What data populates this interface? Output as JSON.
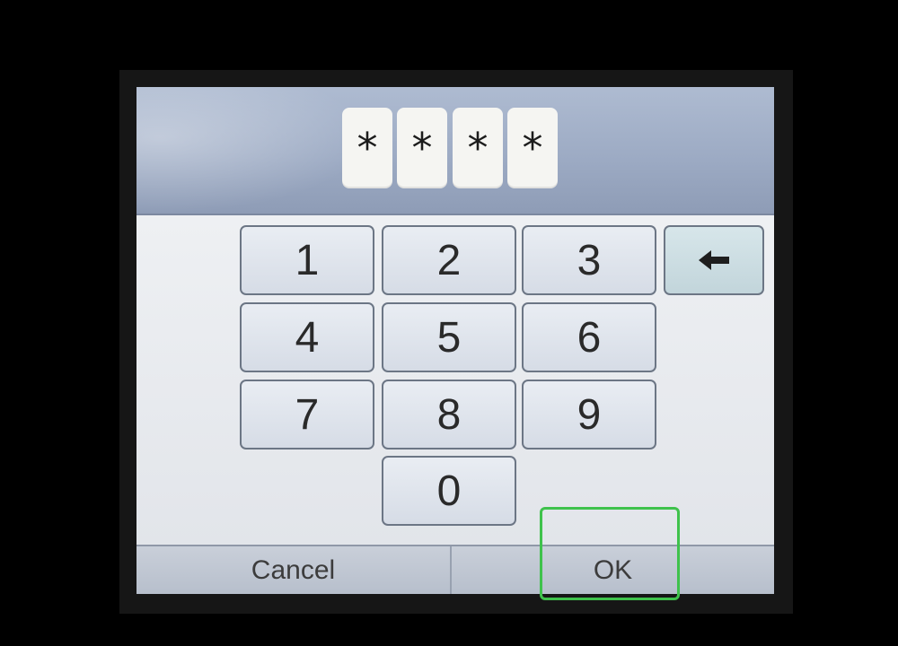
{
  "pin": {
    "cells": [
      "*",
      "*",
      "*",
      "*"
    ]
  },
  "keypad": {
    "keys": [
      "1",
      "2",
      "3",
      "4",
      "5",
      "6",
      "7",
      "8",
      "9",
      "0"
    ],
    "backspace_icon": "arrow-left-icon"
  },
  "bottom_bar": {
    "cancel_label": "Cancel",
    "ok_label": "OK"
  },
  "highlight": {
    "target": "ok-button",
    "color": "#3fc24c"
  }
}
